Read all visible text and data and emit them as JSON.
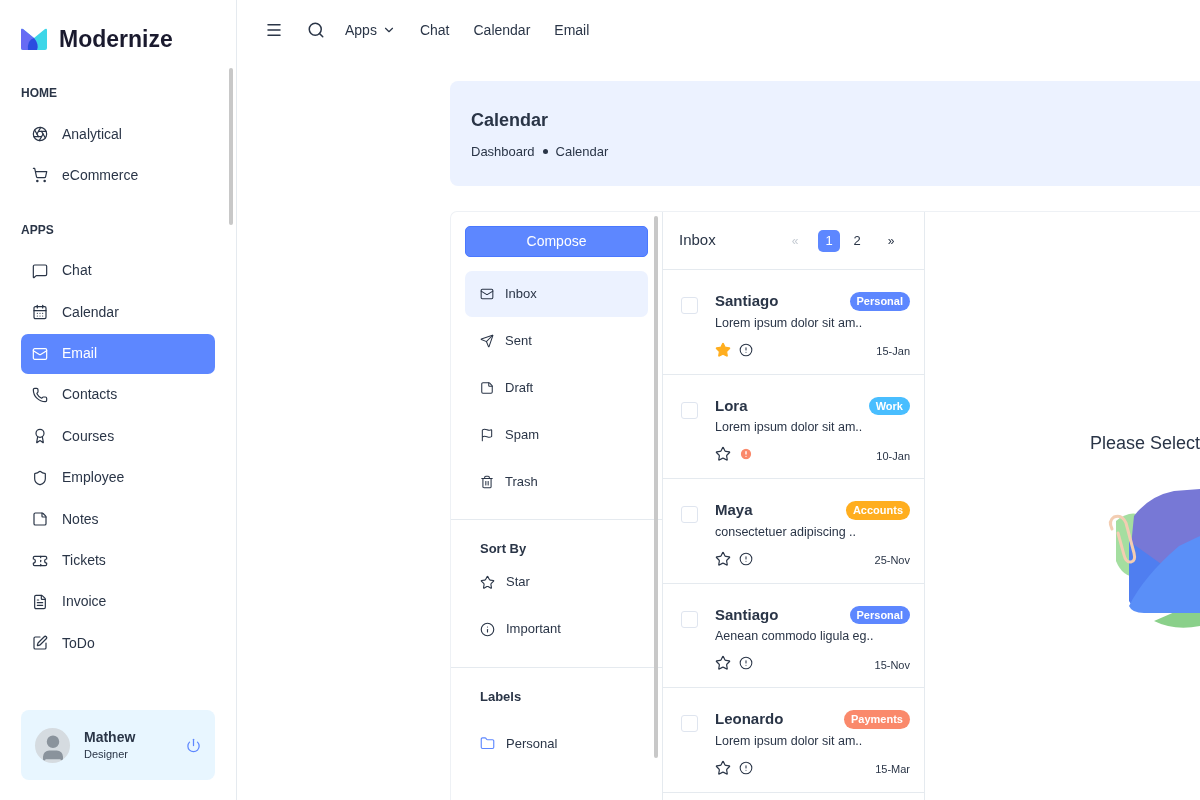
{
  "brand": {
    "name": "Modernize"
  },
  "sidebar": {
    "sections": [
      {
        "title": "HOME",
        "items": [
          {
            "label": "Analytical",
            "selected": false
          },
          {
            "label": "eCommerce",
            "selected": false
          }
        ]
      },
      {
        "title": "APPS",
        "items": [
          {
            "label": "Chat",
            "selected": false
          },
          {
            "label": "Calendar",
            "selected": false
          },
          {
            "label": "Email",
            "selected": true
          },
          {
            "label": "Contacts",
            "selected": false
          },
          {
            "label": "Courses",
            "selected": false
          },
          {
            "label": "Employee",
            "selected": false
          },
          {
            "label": "Notes",
            "selected": false
          },
          {
            "label": "Tickets",
            "selected": false
          },
          {
            "label": "Invoice",
            "selected": false
          },
          {
            "label": "ToDo",
            "selected": false
          }
        ]
      }
    ]
  },
  "profile": {
    "name": "Mathew",
    "role": "Designer"
  },
  "topbar": {
    "links": [
      {
        "label": "Apps",
        "dropdown": true
      },
      {
        "label": "Chat",
        "dropdown": false
      },
      {
        "label": "Calendar",
        "dropdown": false
      },
      {
        "label": "Email",
        "dropdown": false
      }
    ]
  },
  "page_header": {
    "title": "Calendar",
    "breadcrumb": [
      "Dashboard",
      "Calendar"
    ]
  },
  "mail_nav": {
    "compose": "Compose",
    "folders": [
      {
        "label": "Inbox",
        "selected": true
      },
      {
        "label": "Sent",
        "selected": false
      },
      {
        "label": "Draft",
        "selected": false
      },
      {
        "label": "Spam",
        "selected": false
      },
      {
        "label": "Trash",
        "selected": false
      }
    ],
    "sort_title": "Sort By",
    "sort": [
      {
        "label": "Star"
      },
      {
        "label": "Important"
      }
    ],
    "labels_title": "Labels",
    "labels": [
      {
        "label": "Personal"
      }
    ]
  },
  "mail_list": {
    "title": "Inbox",
    "pagination": {
      "prev": "«",
      "next": "»",
      "prev_disabled": true,
      "pages": [
        {
          "label": "1",
          "selected": true
        },
        {
          "label": "2",
          "selected": false
        }
      ]
    },
    "rows": [
      {
        "name": "Santiago",
        "preview": "Lorem ipsum dolor sit am..",
        "tag": "Personal",
        "color": "#5d87ff",
        "starred": true,
        "important": false,
        "checked": false,
        "date": "15-Jan"
      },
      {
        "name": "Lora",
        "preview": "Lorem ipsum dolor sit am..",
        "tag": "Work",
        "color": "#49beff",
        "starred": false,
        "important": true,
        "checked": false,
        "date": "10-Jan"
      },
      {
        "name": "Maya",
        "preview": "consectetuer adipiscing ..",
        "tag": "Accounts",
        "color": "#ffae1f",
        "starred": false,
        "important": false,
        "checked": false,
        "date": "25-Nov"
      },
      {
        "name": "Santiago",
        "preview": "Aenean commodo ligula eg..",
        "tag": "Personal",
        "color": "#5d87ff",
        "starred": false,
        "important": false,
        "checked": false,
        "date": "15-Nov"
      },
      {
        "name": "Leonardo",
        "preview": "Lorem ipsum dolor sit am..",
        "tag": "Payments",
        "color": "#fa896b",
        "starred": false,
        "important": false,
        "checked": false,
        "date": "15-Mar"
      }
    ]
  },
  "detail": {
    "message": "Please Select"
  }
}
